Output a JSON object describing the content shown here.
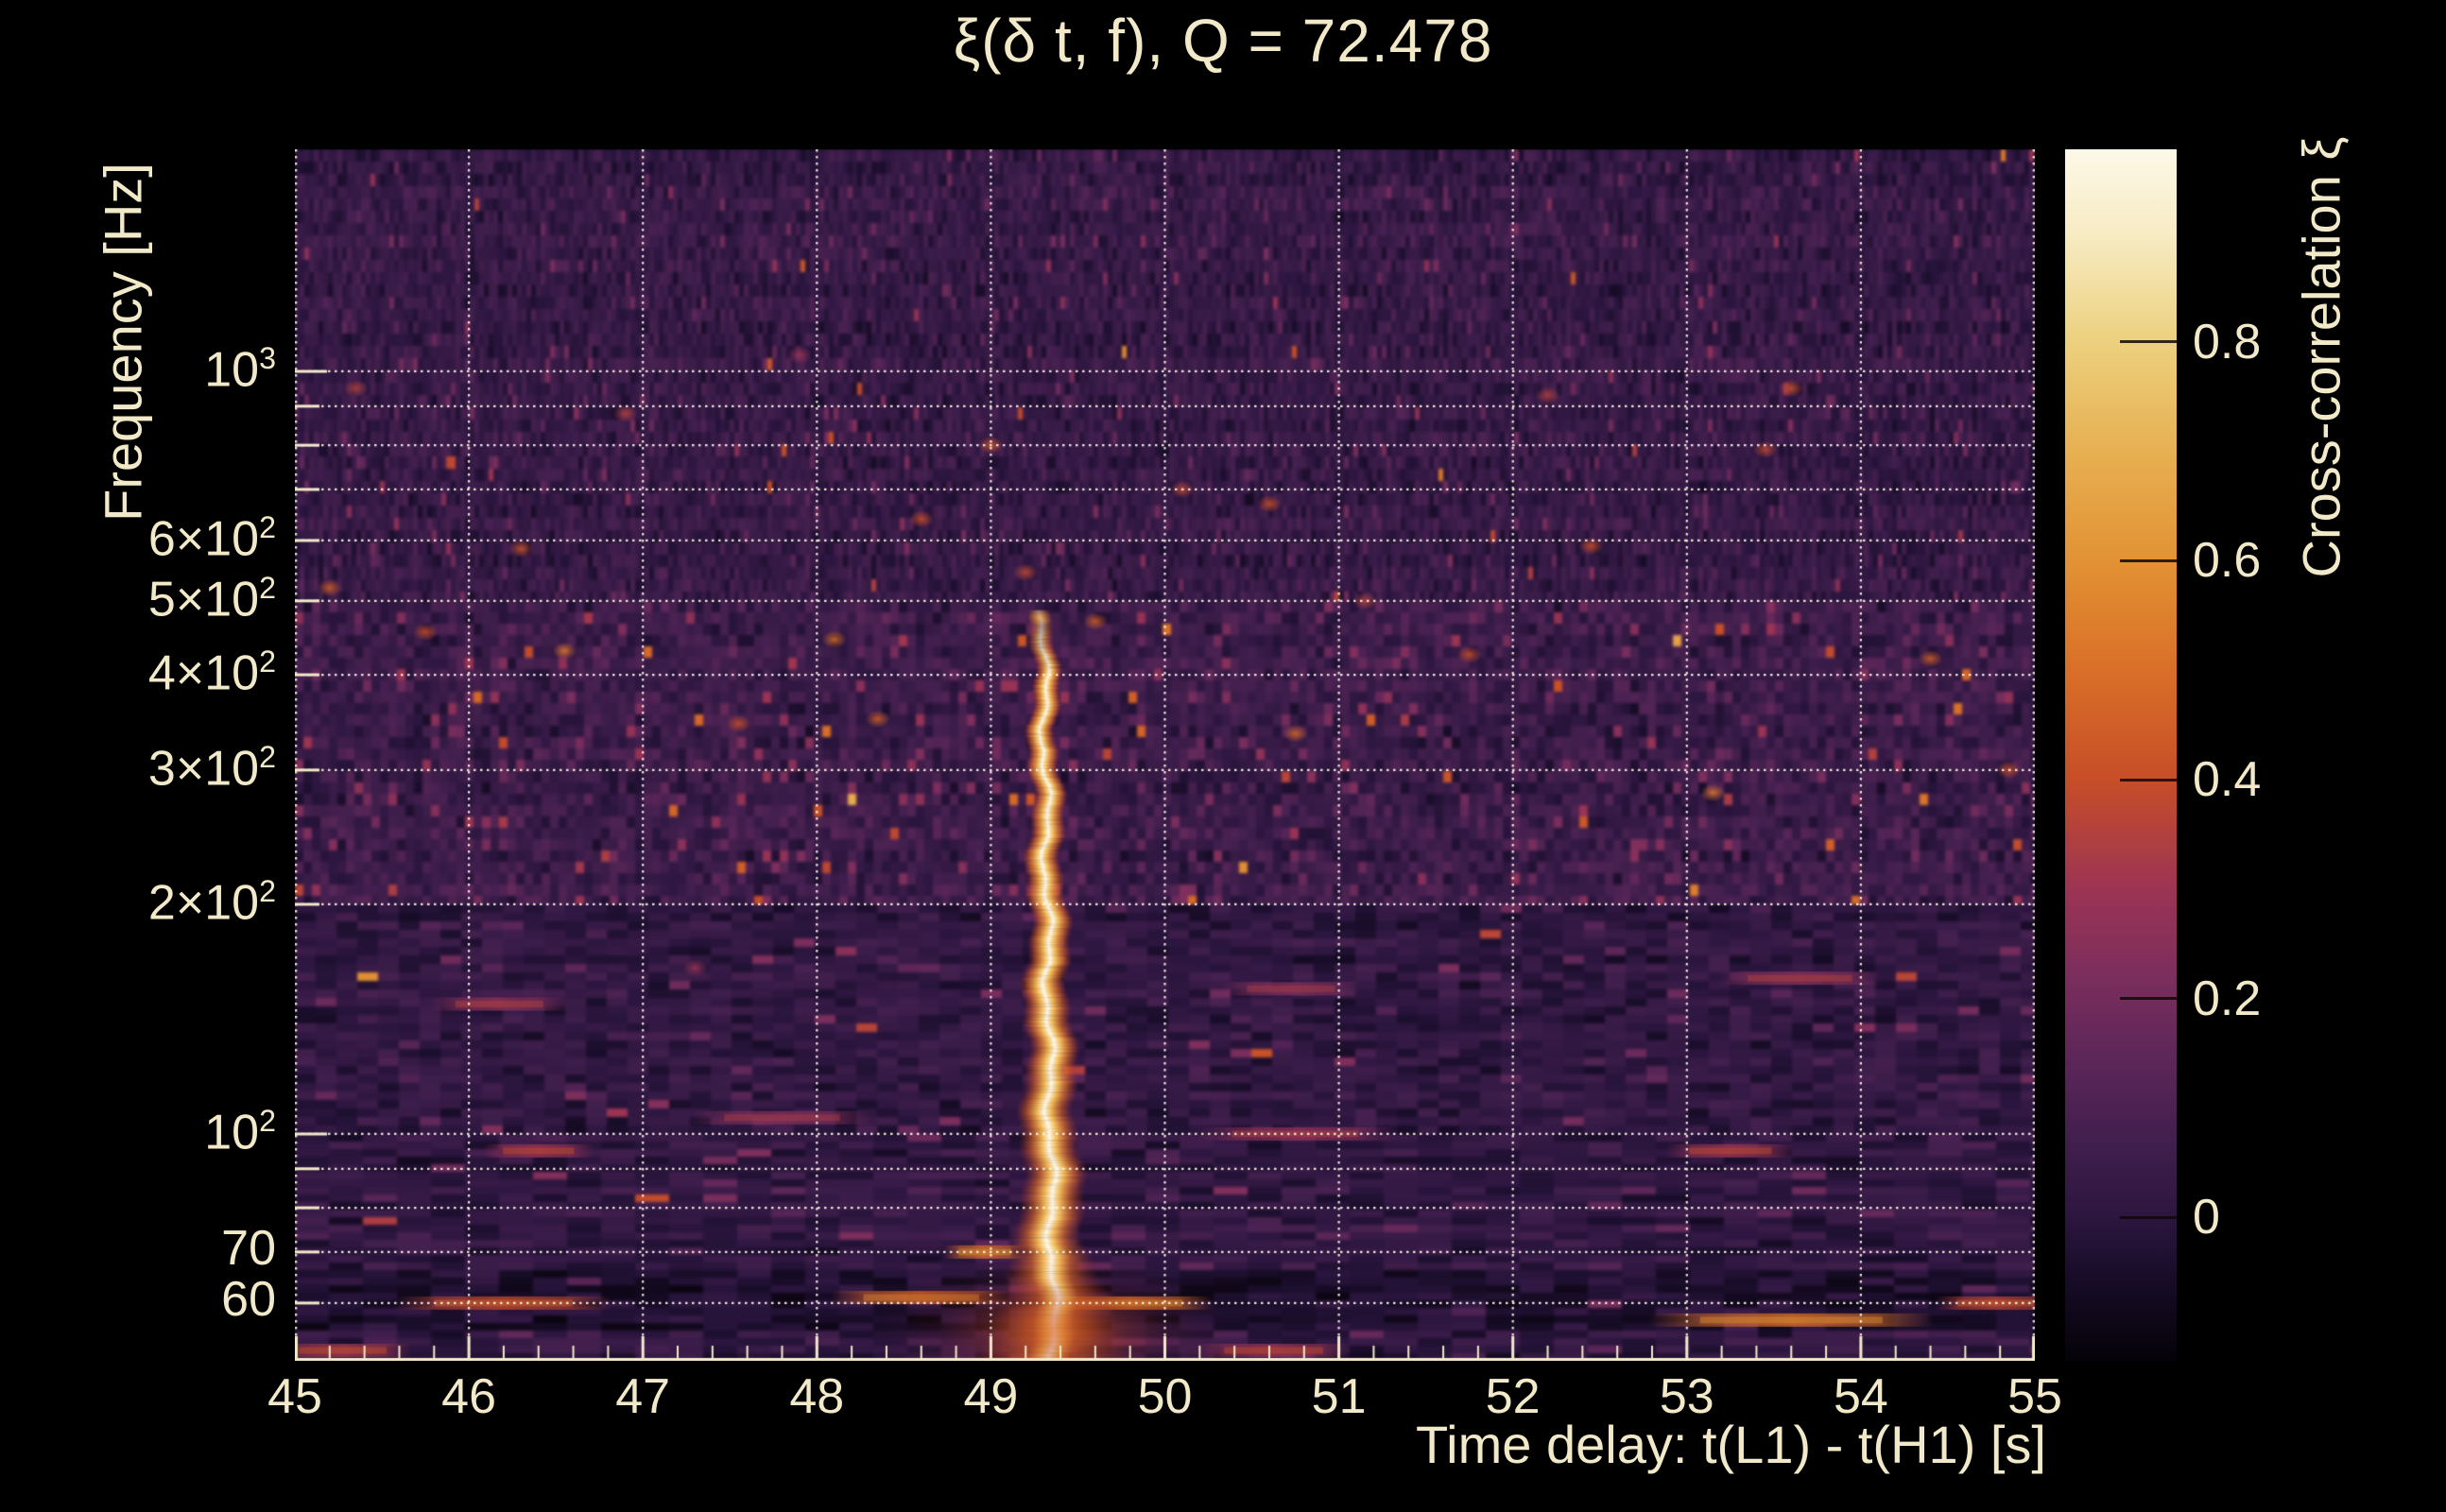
{
  "page": {
    "background": "#000000",
    "text_color": "#f2e9c9"
  },
  "title": "ξ(δ t, f), Q = 72.478",
  "axes": {
    "x": {
      "label": "Time delay: t(L1) - t(H1) [s]",
      "min": 45,
      "max": 55,
      "major_ticks": [
        45,
        46,
        47,
        48,
        49,
        50,
        51,
        52,
        53,
        54,
        55
      ],
      "minor_step": 0.2
    },
    "y": {
      "label": "Frequency [Hz]",
      "scale": "log",
      "min_hz": 50.4,
      "max_hz": 1955,
      "gridlines_hz": [
        60,
        70,
        80,
        90,
        100,
        200,
        300,
        400,
        500,
        600,
        700,
        800,
        900,
        1000
      ],
      "tick_labels": [
        {
          "freq": 1000,
          "base": "10",
          "exp": "3"
        },
        {
          "freq": 600,
          "base": "6×10",
          "exp": "2"
        },
        {
          "freq": 500,
          "base": "5×10",
          "exp": "2"
        },
        {
          "freq": 400,
          "base": "4×10",
          "exp": "2"
        },
        {
          "freq": 300,
          "base": "3×10",
          "exp": "2"
        },
        {
          "freq": 200,
          "base": "2×10",
          "exp": "2"
        },
        {
          "freq": 100,
          "base": "10",
          "exp": "2"
        },
        {
          "freq": 70,
          "base": "70",
          "exp": ""
        },
        {
          "freq": 60,
          "base": "60",
          "exp": ""
        }
      ]
    },
    "colorbar": {
      "label": "Cross-correlation ξ",
      "top_value": 0.976,
      "bottom_value": -0.131,
      "ticks": [
        {
          "value": 0.8,
          "label": "0.8"
        },
        {
          "value": 0.6,
          "label": "0.6"
        },
        {
          "value": 0.4,
          "label": "0.4"
        },
        {
          "value": 0.2,
          "label": "0.2"
        },
        {
          "value": 0,
          "label": "0"
        }
      ],
      "gradient": [
        [
          "0%",
          "#fdf8e8"
        ],
        [
          "6.9%",
          "#f7ecc4"
        ],
        [
          "15.9%",
          "#ecd07e"
        ],
        [
          "24.9%",
          "#e7b052"
        ],
        [
          "34%",
          "#e29234"
        ],
        [
          "43%",
          "#d96f28"
        ],
        [
          "52%",
          "#c74e28"
        ],
        [
          "61.1%",
          "#9c3454"
        ],
        [
          "68.3%",
          "#7b2e5d"
        ],
        [
          "74.6%",
          "#5e2759"
        ],
        [
          "80.9%",
          "#45204f"
        ],
        [
          "88.2%",
          "#2c163f"
        ],
        [
          "92.7%",
          "#190d2a"
        ],
        [
          "100%",
          "#050208"
        ]
      ]
    }
  },
  "chart_data": {
    "type": "heatmap",
    "title": "ξ(δ t, f), Q = 72.478",
    "xlabel": "Time delay: t(L1) - t(H1) [s]",
    "ylabel": "Frequency [Hz]",
    "zlabel": "Cross-correlation ξ",
    "q_value": 72.478,
    "x_range_s": [
      45,
      55
    ],
    "y_range_hz": [
      50.4,
      1955
    ],
    "y_scale": "log",
    "xi_range": [
      -0.131,
      0.976
    ],
    "colorbar_tick_values": [
      0,
      0.2,
      0.4,
      0.6,
      0.8
    ],
    "grid": "dotted, at integer seconds and log-decade frequencies",
    "noise_floor_xi": [
      -0.1,
      0.15
    ],
    "colormap": "magma-like (black-purple-red-orange-cream)",
    "main_feature": {
      "description": "Narrow vertical band of strong cross-correlation",
      "time_delay_s": 49.3,
      "time_drift_s": 0.06,
      "freq_span_hz": [
        50,
        470
      ],
      "peak_xi": 0.95
    },
    "smears": [
      {
        "t0": 45.0,
        "t1": 45.55,
        "f": 52,
        "xi": 0.32
      },
      {
        "t0": 45.7,
        "t1": 46.7,
        "f": 60,
        "xi": 0.38
      },
      {
        "t0": 48.2,
        "t1": 49.0,
        "f": 61,
        "xi": 0.46
      },
      {
        "t0": 49.45,
        "t1": 50.15,
        "f": 60,
        "xi": 0.5
      },
      {
        "t0": 50.3,
        "t1": 50.95,
        "f": 52,
        "xi": 0.3
      },
      {
        "t0": 52.9,
        "t1": 54.3,
        "f": 57,
        "xi": 0.5
      },
      {
        "t0": 54.55,
        "t1": 55.0,
        "f": 60,
        "xi": 0.36
      },
      {
        "t0": 48.85,
        "t1": 49.08,
        "f": 70,
        "xi": 0.5
      },
      {
        "t0": 50.3,
        "t1": 51.2,
        "f": 100,
        "xi": 0.26
      },
      {
        "t0": 47.4,
        "t1": 48.2,
        "f": 105,
        "xi": 0.24
      },
      {
        "t0": 45.9,
        "t1": 46.45,
        "f": 148,
        "xi": 0.26
      },
      {
        "t0": 53.3,
        "t1": 54.0,
        "f": 160,
        "xi": 0.26
      },
      {
        "t0": 50.45,
        "t1": 51.0,
        "f": 155,
        "xi": 0.24
      },
      {
        "t0": 46.2,
        "t1": 46.6,
        "f": 95,
        "xi": 0.3
      },
      {
        "t0": 53.0,
        "t1": 53.5,
        "f": 95,
        "xi": 0.3
      }
    ],
    "hotspots": [
      {
        "t": 45.2,
        "f": 520,
        "xi": 0.45
      },
      {
        "t": 45.75,
        "f": 455,
        "xi": 0.4
      },
      {
        "t": 46.3,
        "f": 585,
        "xi": 0.42
      },
      {
        "t": 46.55,
        "f": 430,
        "xi": 0.52
      },
      {
        "t": 47.3,
        "f": 165,
        "xi": 0.3
      },
      {
        "t": 47.55,
        "f": 345,
        "xi": 0.4
      },
      {
        "t": 48.1,
        "f": 445,
        "xi": 0.5
      },
      {
        "t": 48.35,
        "f": 350,
        "xi": 0.45
      },
      {
        "t": 48.6,
        "f": 640,
        "xi": 0.4
      },
      {
        "t": 49.0,
        "f": 800,
        "xi": 0.42
      },
      {
        "t": 49.28,
        "f": 475,
        "xi": 0.6
      },
      {
        "t": 49.2,
        "f": 545,
        "xi": 0.38
      },
      {
        "t": 49.6,
        "f": 470,
        "xi": 0.45
      },
      {
        "t": 50.1,
        "f": 700,
        "xi": 0.38
      },
      {
        "t": 50.6,
        "f": 670,
        "xi": 0.4
      },
      {
        "t": 50.75,
        "f": 335,
        "xi": 0.48
      },
      {
        "t": 51.15,
        "f": 500,
        "xi": 0.36
      },
      {
        "t": 51.75,
        "f": 425,
        "xi": 0.4
      },
      {
        "t": 52.45,
        "f": 590,
        "xi": 0.4
      },
      {
        "t": 53.15,
        "f": 280,
        "xi": 0.52
      },
      {
        "t": 53.45,
        "f": 790,
        "xi": 0.38
      },
      {
        "t": 53.6,
        "f": 950,
        "xi": 0.4
      },
      {
        "t": 54.4,
        "f": 420,
        "xi": 0.46
      },
      {
        "t": 54.85,
        "f": 300,
        "xi": 0.4
      },
      {
        "t": 45.35,
        "f": 950,
        "xi": 0.35
      },
      {
        "t": 46.9,
        "f": 880,
        "xi": 0.35
      },
      {
        "t": 52.2,
        "f": 930,
        "xi": 0.35
      },
      {
        "t": 47.9,
        "f": 1050,
        "xi": 0.3
      }
    ]
  }
}
